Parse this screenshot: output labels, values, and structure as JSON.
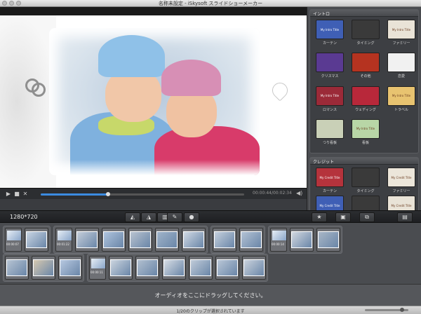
{
  "window": {
    "title": "名称未設定 - iSkysoft スライドショーメーカー"
  },
  "player": {
    "timecode": "00:00:44/00:02:34",
    "progress": 0.33
  },
  "intro": {
    "title": "イントロ",
    "items": [
      {
        "label": "カーテン",
        "thumb_text": "My Intro Title",
        "color": "#3f5fb5"
      },
      {
        "label": "タイミング",
        "thumb_text": "",
        "color": "#3a3a3a"
      },
      {
        "label": "ファミリー",
        "thumb_text": "My Intro Title",
        "color": "#e9e3d7"
      },
      {
        "label": "クリスマス",
        "thumb_text": "",
        "color": "#5a3a92"
      },
      {
        "label": "その他",
        "thumb_text": "",
        "color": "#b53320"
      },
      {
        "label": "恋愛",
        "thumb_text": "",
        "color": "#f1f1f1"
      },
      {
        "label": "ロマンス",
        "thumb_text": "My Intro Title",
        "color": "#9b2a38"
      },
      {
        "label": "ウェディング",
        "thumb_text": "",
        "color": "#b8283a"
      },
      {
        "label": "トラベル",
        "thumb_text": "My Intro Title",
        "color": "#e8c370"
      },
      {
        "label": "つり看板",
        "thumb_text": "",
        "color": "#c9d0b7"
      },
      {
        "label": "看板",
        "thumb_text": "My Intro Title",
        "color": "#b8d6a6"
      }
    ]
  },
  "credit": {
    "title": "クレジット",
    "items": [
      {
        "label": "カーテン",
        "thumb_text": "My Credit Title",
        "color": "#b5333c"
      },
      {
        "label": "タイミング",
        "thumb_text": "",
        "color": "#3a3a3a"
      },
      {
        "label": "ファミリー",
        "thumb_text": "My Credit Title",
        "color": "#ece6da"
      },
      {
        "label": "",
        "thumb_text": "My Credit Title",
        "color": "#3f5fb5"
      },
      {
        "label": "",
        "thumb_text": "",
        "color": "#3a3a3a"
      },
      {
        "label": "",
        "thumb_text": "My Credit Title",
        "color": "#e9e3d7"
      }
    ]
  },
  "toolbar": {
    "resolution": "1280*720"
  },
  "storyboard": {
    "row1": [
      {
        "dur": "00:00:07",
        "slides": [
          "#c8d4e2"
        ]
      },
      {
        "dur": "00:01:22",
        "slides": [
          "#c3ccd8",
          "#aec3dd",
          "#b8c2cf",
          "#9fb3c9",
          "#cfd8e3"
        ]
      },
      {
        "dur": "",
        "slides": [
          "#c4cfdc",
          "#b3c2d4"
        ]
      },
      {
        "dur": "00:00:14",
        "slides": [
          "#d1d7df",
          "#a8b6c6"
        ]
      }
    ],
    "row2": [
      {
        "dur": "",
        "slides": [
          "#b6c3d2",
          "#d6c8b0",
          "#b7c8e0"
        ]
      },
      {
        "dur": "00:00:11",
        "slides": [
          "#cbd4de",
          "#b1bfcf",
          "#d7dde4",
          "#c0cbd8",
          "#b9c6d6",
          "#cad2dc"
        ]
      }
    ]
  },
  "audio": {
    "placeholder": "オーディオをここにドラッグしてください。"
  },
  "status": {
    "text": "1/20のクリップが選択されています"
  }
}
